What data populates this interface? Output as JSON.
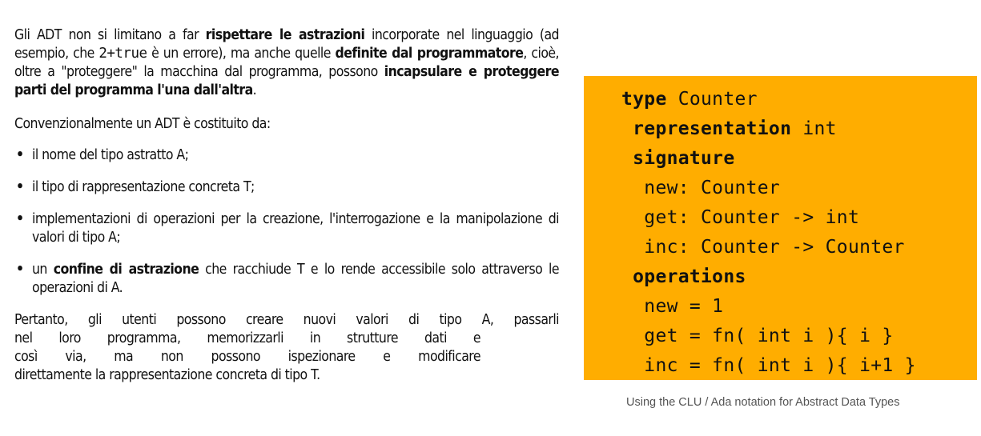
{
  "paragraph1": {
    "t1": "Gli ADT non si limitano a far ",
    "b1": "rispettare le astrazioni",
    "t2": " incorporate nel linguaggio (ad esempio, che ",
    "code": "2+true",
    "t3": " è un errore), ma anche quelle ",
    "b2": "definite dal programmatore",
    "t4": ", cioè, oltre a \"proteggere\" la macchina dal programma, possono ",
    "b3": "incapsulare e proteggere parti del programma l'una dall'altra",
    "t5": "."
  },
  "paragraph2": "Convenzionalmente un ADT è costituito da:",
  "bullets": {
    "glyph": "•",
    "items": [
      {
        "text": "il nome del tipo astratto A;"
      },
      {
        "text": "il tipo di rappresentazione concreta T;"
      },
      {
        "text": "implementazioni di operazioni per la creazione, l'interrogazione e la manipolazione di valori di tipo A;"
      },
      {
        "pre": "un ",
        "bold": "confine di astrazione",
        "post": " che racchiude T e lo rende accessibile solo attraverso le operazioni di A."
      }
    ]
  },
  "paragraph3": {
    "lines": [
      "Pertanto, gli utenti possono creare nuovi valori di tipo A, passarli",
      "nel loro programma, memorizzarli in strutture dati e",
      "così via, ma non possono ispezionare e modificare",
      "direttamente la rappresentazione concreta di tipo T."
    ]
  },
  "code_box": {
    "background": "#ffad00",
    "lines": [
      {
        "kw": "type",
        "rest": " Counter",
        "indent": ""
      },
      {
        "kw": "representation",
        "rest": " int",
        "indent": " "
      },
      {
        "kw": "signature",
        "rest": "",
        "indent": " "
      },
      {
        "kw": "",
        "rest": "new: Counter",
        "indent": "  "
      },
      {
        "kw": "",
        "rest": "get: Counter -> int",
        "indent": "  "
      },
      {
        "kw": "",
        "rest": "inc: Counter -> Counter",
        "indent": "  "
      },
      {
        "kw": "operations",
        "rest": "",
        "indent": " "
      },
      {
        "kw": "",
        "rest": "new = 1",
        "indent": "  "
      },
      {
        "kw": "",
        "rest": "get = fn( int i ){ i }",
        "indent": "  "
      },
      {
        "kw": "",
        "rest": "inc = fn( int i ){ i+1 }",
        "indent": "  "
      }
    ]
  },
  "caption": "Using the CLU / Ada notation for Abstract Data Types"
}
